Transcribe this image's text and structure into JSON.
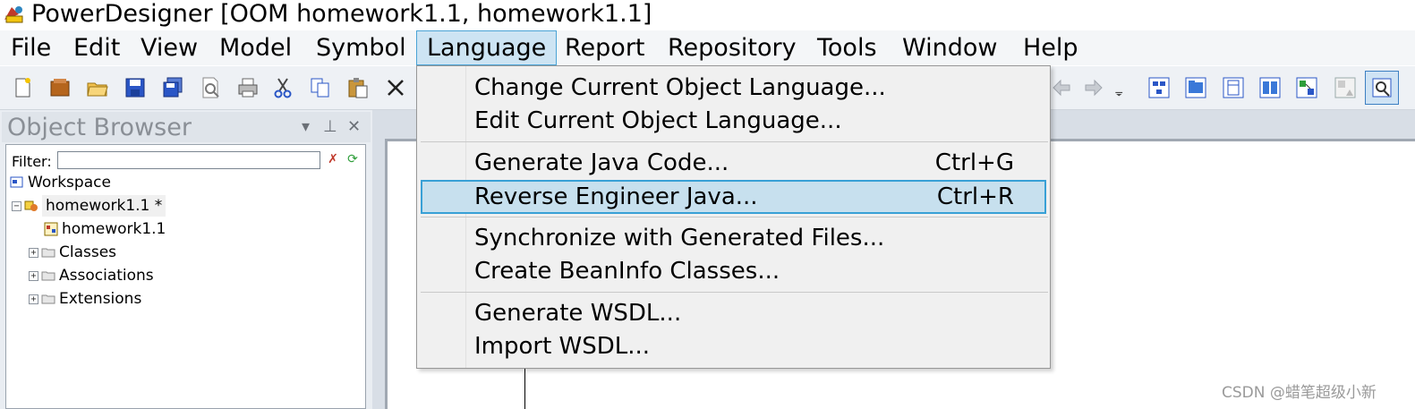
{
  "window": {
    "title": "PowerDesigner [OOM homework1.1, homework1.1]"
  },
  "menubar": {
    "items": [
      "File",
      "Edit",
      "View",
      "Model",
      "Symbol",
      "Language",
      "Report",
      "Repository",
      "Tools",
      "Window",
      "Help"
    ],
    "active": "Language"
  },
  "toolbar": {
    "left_icons": [
      "new-icon",
      "model-icon",
      "open-icon",
      "save-icon",
      "save-all-icon",
      "print-preview-icon",
      "print-icon",
      "cut-icon",
      "copy-icon",
      "paste-icon",
      "delete-icon"
    ],
    "right_icons": [
      "undo-icon",
      "redo-icon",
      "overflow-icon",
      "diagram-icon",
      "package-icon",
      "class-icon",
      "interface-icon",
      "component-icon",
      "inheritance-icon",
      "select-icon"
    ]
  },
  "object_browser": {
    "title": "Object Browser",
    "filter_label": "Filter:",
    "filter_value": "",
    "tree": {
      "workspace": "Workspace",
      "model": "homework1.1 *",
      "diagram": "homework1.1",
      "classes": "Classes",
      "associations": "Associations",
      "extensions": "Extensions"
    }
  },
  "language_menu": {
    "items": [
      {
        "label": "Change Current Object Language...",
        "shortcut": ""
      },
      {
        "label": "Edit Current Object Language...",
        "shortcut": ""
      },
      {
        "label": "Generate Java Code...",
        "shortcut": "Ctrl+G"
      },
      {
        "label": "Reverse Engineer Java...",
        "shortcut": "Ctrl+R",
        "highlighted": true
      },
      {
        "label": "Synchronize with Generated Files...",
        "shortcut": ""
      },
      {
        "label": "Create BeanInfo Classes...",
        "shortcut": ""
      },
      {
        "label": "Generate WSDL...",
        "shortcut": ""
      },
      {
        "label": "Import WSDL...",
        "shortcut": ""
      }
    ]
  },
  "watermark": "CSDN @蜡笔超级小新",
  "colors": {
    "menu_highlight": "#c7e0ee",
    "menu_highlight_border": "#38a0d6",
    "active_menu": "#cde4f3"
  }
}
